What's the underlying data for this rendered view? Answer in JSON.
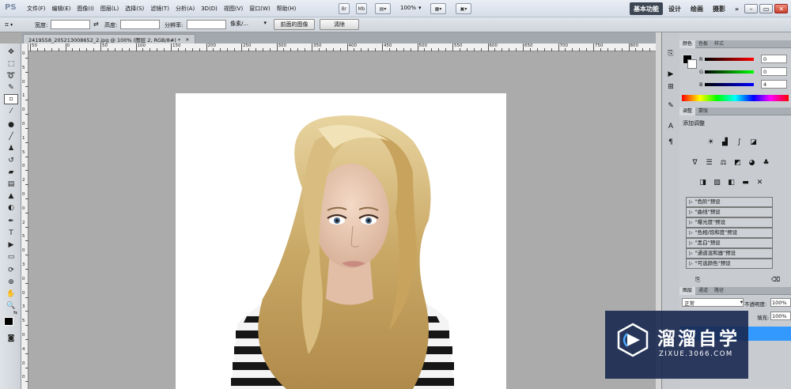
{
  "app": {
    "logo": "PS"
  },
  "menu": [
    {
      "label": "文件(F)"
    },
    {
      "label": "编辑(E)"
    },
    {
      "label": "图像(I)"
    },
    {
      "label": "图层(L)"
    },
    {
      "label": "选择(S)"
    },
    {
      "label": "滤镜(T)"
    },
    {
      "label": "分析(A)"
    },
    {
      "label": "3D(D)"
    },
    {
      "label": "视图(V)"
    },
    {
      "label": "窗口(W)"
    },
    {
      "label": "帮助(H)"
    }
  ],
  "toolbar": {
    "br_label": "Br",
    "mb_label": "Mb",
    "zoom": "100%"
  },
  "workspaces": {
    "active": "基本功能",
    "design": "设计",
    "painting": "绘画",
    "photography": "摄影",
    "more": "»"
  },
  "window_controls": {
    "minimize": "–",
    "restore": "▭",
    "close": "✕"
  },
  "options": {
    "width_label": "宽度:",
    "width_value": "",
    "height_label": "高度:",
    "height_value": "",
    "resolution_label": "分辨率:",
    "resolution_value": "",
    "unit_value": "像素/...",
    "front_image_button": "前面的图像",
    "clear_button": "清除"
  },
  "document": {
    "tab_title": "2419558_205213008652_2.jpg @ 100% (图层 2, RGB/8#) *",
    "close": "×"
  },
  "rulers": {
    "top_labels": [
      "50",
      "0",
      "50",
      "100",
      "150",
      "200",
      "250",
      "300",
      "350",
      "400",
      "450",
      "500",
      "550",
      "600",
      "650",
      "700",
      "750",
      "800"
    ],
    "left_labels": [
      "0",
      "5",
      "0",
      "1",
      "0",
      "0",
      "1",
      "5",
      "0",
      "2",
      "0",
      "0",
      "2",
      "5",
      "0",
      "3",
      "0",
      "0",
      "3",
      "5",
      "0",
      "4",
      "0",
      "0"
    ]
  },
  "color_panel": {
    "tabs": [
      "颜色",
      "色板",
      "样式"
    ],
    "r_label": "R",
    "g_label": "G",
    "b_label": "B",
    "r_value": "0",
    "g_value": "0",
    "b_value": "4"
  },
  "adjust_panel": {
    "tabs": [
      "调整",
      "蒙版"
    ],
    "title": "添加调整",
    "presets": [
      "\"色阶\"预设",
      "\"曲线\"预设",
      "\"曝光度\"预设",
      "\"色相/饱和度\"预设",
      "\"黑白\"预设",
      "\"通道混和器\"预设",
      "\"可选颜色\"预设"
    ]
  },
  "layers_panel": {
    "tabs": [
      "图层",
      "通道",
      "路径"
    ],
    "blend_mode": "正常",
    "opacity_label": "不透明度:",
    "opacity_value": "100%",
    "fill_label": "填充:",
    "fill_value": "100%"
  },
  "watermark": {
    "title": "溜溜自学",
    "url": "ZIXUE.3066.COM"
  },
  "colors": {
    "accent": "#3399ff",
    "workspace_active": "#3d4754"
  }
}
